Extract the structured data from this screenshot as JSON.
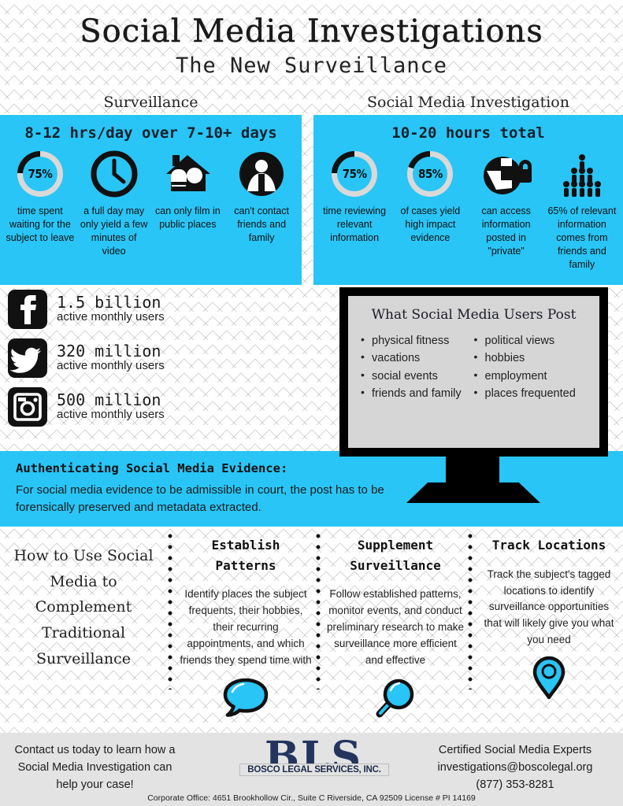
{
  "header": {
    "title": "Social Media Investigations",
    "subtitle": "The New Surveillance",
    "col_left": "Surveillance",
    "col_right": "Social Media Investigation"
  },
  "colors": {
    "accent_blue": "#29c5f6",
    "panel_black": "#111111",
    "screen_gray": "#d6d6d6",
    "footer_gray": "#e3e3e3",
    "logo_navy": "#23355e"
  },
  "panel_left": {
    "title": "8-12 hrs/day over 7-10+ days",
    "items": [
      {
        "icon": "donut-chart-icon",
        "value": "75%",
        "percent": 75,
        "caption": "time spent waiting for the subject to leave"
      },
      {
        "icon": "clock-icon",
        "value": "",
        "caption": "a full day may only yield a few minutes of video"
      },
      {
        "icon": "house-camera-icon",
        "value": "",
        "caption": "can only film in public places"
      },
      {
        "icon": "person-icon",
        "value": "",
        "caption": "can't contact friends and family"
      }
    ]
  },
  "panel_right": {
    "title": "10-20 hours total",
    "items": [
      {
        "icon": "donut-chart-icon",
        "value": "75%",
        "percent": 75,
        "caption": "time reviewing relevant information"
      },
      {
        "icon": "donut-chart-icon",
        "value": "85%",
        "percent": 85,
        "caption": "of cases yield high impact evidence"
      },
      {
        "icon": "globe-lock-icon",
        "value": "",
        "caption": "can access information posted in \"private\""
      },
      {
        "icon": "people-group-icon",
        "value": "",
        "caption": "65% of relevant information comes from friends and family"
      }
    ]
  },
  "social_stats": [
    {
      "icon": "facebook-icon",
      "number": "1.5 billion",
      "label": "active monthly users"
    },
    {
      "icon": "twitter-icon",
      "number": "320 million",
      "label": "active monthly users"
    },
    {
      "icon": "instagram-icon",
      "number": "500 million",
      "label": "active monthly users"
    }
  ],
  "tv": {
    "title": "What Social Media Users Post",
    "column_a": [
      "physical fitness",
      "vacations",
      "social events",
      "friends and family"
    ],
    "column_b": [
      "political views",
      "hobbies",
      "employment",
      "places frequented"
    ]
  },
  "auth": {
    "title": "Authenticating Social Media Evidence:",
    "body": "For social media evidence to be admissible in court, the post has to be forensically preserved and metadata extracted."
  },
  "howto": {
    "title": "How to Use Social Media to Complement Traditional Surveillance",
    "columns": [
      {
        "title": "Establish Patterns",
        "body": "Identify places the subject frequents, their hobbies, their recurring appointments, and which friends they spend time with",
        "icon": "speech-bubble-icon"
      },
      {
        "title": "Supplement Surveillance",
        "body": "Follow established patterns, monitor events, and conduct preliminary research to make surveillance more efficient and effective",
        "icon": "magnifying-glass-icon"
      },
      {
        "title": "Track Locations",
        "body": "Track the subject's tagged locations to identify surveillance opportunities that will likely give you what you need",
        "icon": "location-pin-icon"
      }
    ]
  },
  "footer": {
    "left": "Contact us today to learn how a Social Media Investigation can help your case!",
    "logo_main": "BLS",
    "logo_sub": "BOSCO LEGAL SERVICES, INC.",
    "right_line1": "Certified Social Media Experts",
    "right_line2": "investigations@boscolegal.org",
    "right_line3": "(877) 353-8281",
    "address": "Corporate Office: 4651 Brookhollow Cir., Suite C Riverside, CA 92509 License # PI 14169"
  }
}
